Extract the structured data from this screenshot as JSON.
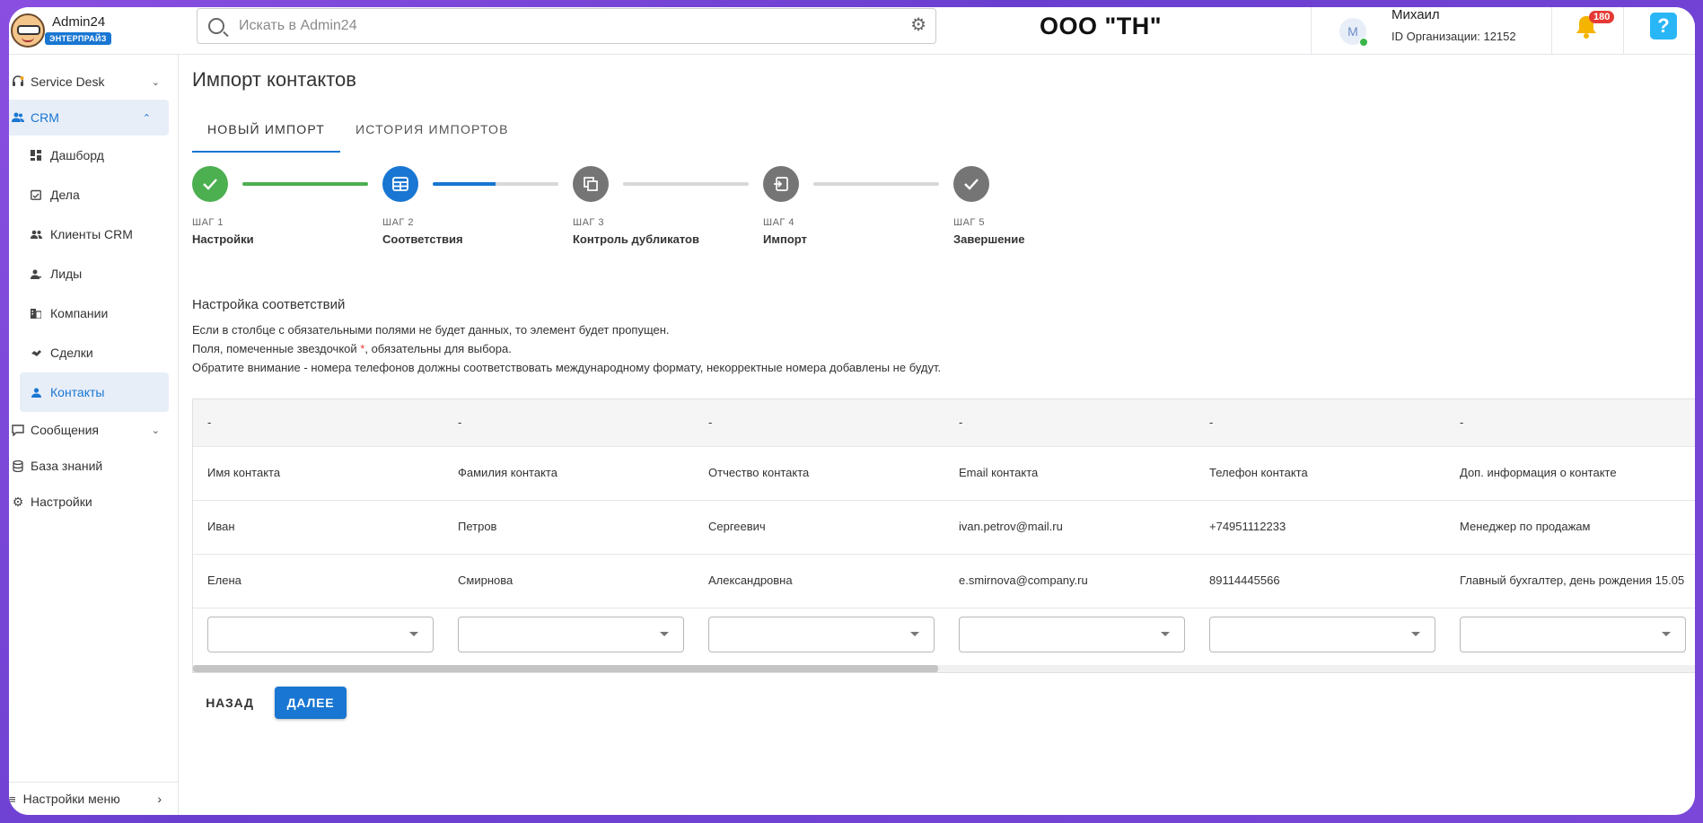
{
  "app": {
    "name": "Admin24",
    "plan_badge": "ЭНТЕРПРАЙЗ"
  },
  "search": {
    "placeholder": "Искать в Admin24"
  },
  "org_title": "ООО \"ТН\"",
  "user": {
    "initial": "М",
    "name": "Михаил",
    "org_id": "ID Организации: 12152"
  },
  "notifications": {
    "count": "180"
  },
  "help": {
    "label": "?"
  },
  "sidebar": {
    "items": [
      {
        "label": "Service Desk"
      },
      {
        "label": "CRM"
      },
      {
        "label": "Дашборд"
      },
      {
        "label": "Дела"
      },
      {
        "label": "Клиенты CRM"
      },
      {
        "label": "Лиды"
      },
      {
        "label": "Компании"
      },
      {
        "label": "Сделки"
      },
      {
        "label": "Контакты"
      },
      {
        "label": "Сообщения"
      },
      {
        "label": "База знаний"
      },
      {
        "label": "Настройки"
      }
    ],
    "menu_settings": "Настройки меню"
  },
  "page": {
    "title": "Импорт контактов",
    "tabs": [
      {
        "label": "НОВЫЙ ИМПОРТ"
      },
      {
        "label": "ИСТОРИЯ ИМПОРТОВ"
      }
    ],
    "steps": [
      {
        "num": "ШАГ 1",
        "label": "Настройки",
        "status": "done",
        "color": "#4caf50"
      },
      {
        "num": "ШАГ 2",
        "label": "Соответствия",
        "status": "current",
        "color": "#1976d2"
      },
      {
        "num": "ШАГ 3",
        "label": "Контроль дубликатов",
        "status": "pending",
        "color": "#757575"
      },
      {
        "num": "ШАГ 4",
        "label": "Импорт",
        "status": "pending",
        "color": "#757575"
      },
      {
        "num": "ШАГ 5",
        "label": "Завершение",
        "status": "pending",
        "color": "#757575"
      }
    ],
    "step_progress": [
      1.0,
      0.5,
      0,
      0
    ],
    "section_title": "Настройка соответствий",
    "hint1": "Если в столбце с обязательными полями не будет данных, то элемент будет пропущен.",
    "hint2_a": "Поля, помеченные звездочкой ",
    "hint2_star": "*",
    "hint2_b": ", обязательны для выбора.",
    "hint3": "Обратите внимание - номера телефонов должны соответствовать международному формату, некорректные номера добавлены не будут.",
    "table": {
      "header": [
        "-",
        "-",
        "-",
        "-",
        "-",
        "-"
      ],
      "rows": [
        [
          "Имя контакта",
          "Фамилия контакта",
          "Отчество контакта",
          "Email контакта",
          "Телефон контакта",
          "Доп. информация о контакте"
        ],
        [
          "Иван",
          "Петров",
          "Сергеевич",
          "ivan.petrov@mail.ru",
          "+74951112233",
          "Менеджер по продажам"
        ],
        [
          "Елена",
          "Смирнова",
          "Александровна",
          "e.smirnova@company.ru",
          "89114445566",
          "Главный бухгалтер, день рождения 15.05"
        ]
      ]
    },
    "buttons": {
      "back": "НАЗАД",
      "next": "ДАЛЕЕ"
    }
  }
}
